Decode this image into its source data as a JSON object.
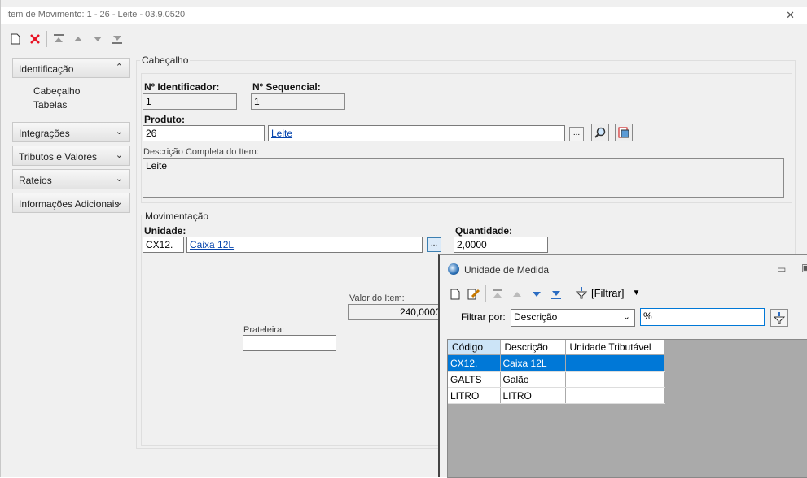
{
  "window": {
    "title": "Item de Movimento: 1 - 26 - Leite - 03.9.0520"
  },
  "sidebar": {
    "groups": [
      {
        "label": "Identificação",
        "expanded": true,
        "items": [
          "Cabeçalho",
          "Tabelas"
        ]
      },
      {
        "label": "Integrações",
        "expanded": false
      },
      {
        "label": "Tributos e Valores",
        "expanded": false
      },
      {
        "label": "Rateios",
        "expanded": false
      },
      {
        "label": "Informações Adicionais",
        "expanded": false
      }
    ]
  },
  "header": {
    "caption": "Cabeçalho",
    "id_label": "Nº Identificador:",
    "id_value": "1",
    "seq_label": "Nº Sequencial:",
    "seq_value": "1",
    "produto_label": "Produto:",
    "produto_code": "26",
    "produto_name": "Leite",
    "descricao_label": "Descrição Completa do Item:",
    "descricao_value": "Leite"
  },
  "movimentacao": {
    "caption": "Movimentação",
    "unidade_label": "Unidade:",
    "unidade_code": "CX12.",
    "unidade_name": "Caixa 12L",
    "quantidade_label": "Quantidade:",
    "quantidade_value": "2,0000",
    "valor_label": "Valor do Item:",
    "valor_value": "240,0000",
    "prateleira_label": "Prateleira:",
    "prateleira_value": ""
  },
  "dialog": {
    "title": "Unidade de Medida",
    "filter_button": "[Filtrar]",
    "filter_by_label": "Filtrar por:",
    "filter_field": "Descrição",
    "filter_value": "%",
    "columns": [
      "Código",
      "Descrição",
      "Unidade Tributável"
    ],
    "rows": [
      {
        "codigo": "CX12.",
        "descricao": "Caixa 12L",
        "trib": "",
        "selected": true
      },
      {
        "codigo": "GALTS",
        "descricao": "Galão",
        "trib": "",
        "selected": false
      },
      {
        "codigo": "LITRO",
        "descricao": "LITRO",
        "trib": "",
        "selected": false
      }
    ]
  },
  "colors": {
    "selection": "#0078d7",
    "delete_icon": "#e81123",
    "link": "#0645ad"
  }
}
